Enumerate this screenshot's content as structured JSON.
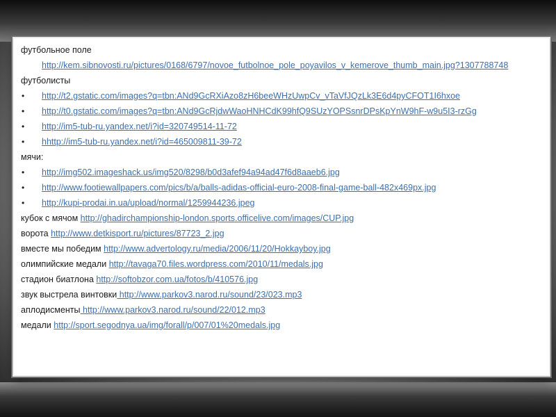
{
  "items": [
    {
      "type": "label",
      "text": "футбольное поле"
    },
    {
      "type": "indent-link",
      "link": "http://kem.sibnovosti.ru/pictures/0168/6797/novoe_futbolnoe_pole_poyavilos_v_kemerove_thumb_main.jpg?1307788748"
    },
    {
      "type": "label",
      "text": "футболисты"
    },
    {
      "type": "bullet",
      "link": "http://t2.gstatic.com/images?q=tbn:ANd9GcRXiAzo8zH6beeWHzUwpCv_vTaVfJQzLk3E6d4pyCFOT1I6hxoe"
    },
    {
      "type": "bullet",
      "link": "http://t0.gstatic.com/images?q=tbn:ANd9GcRjdwWaoHNHCdK99hfQ9SUzYOPSsnrDPsKpYnW9hF-w9u5I3-rzGg"
    },
    {
      "type": "bullet",
      "link": "http://im5-tub-ru.yandex.net/i?id=320749514-11-72"
    },
    {
      "type": "bullet",
      "link": "hhttp://im5-tub-ru.yandex.net/i?id=465009811-39-72"
    },
    {
      "type": "label",
      "text": "мячи:"
    },
    {
      "type": "bullet",
      "link": "http://img502.imageshack.us/img520/8298/b0d3afef94a94ad47f6d8aaeb6.jpg"
    },
    {
      "type": "bullet",
      "link": "http://www.footiewallpapers.com/pics/b/a/balls-adidas-official-euro-2008-final-game-ball-482x469px.jpg"
    },
    {
      "type": "bullet",
      "link": "http://kupi-prodai.in.ua/upload/normal/1259944236.jpeg"
    },
    {
      "type": "line",
      "text": "кубок с мячом ",
      "link": "http://ghadirchampionship-london.sports.officelive.com/images/CUP.jpg"
    },
    {
      "type": "line",
      "text": "ворота ",
      "link": "http://www.detkisport.ru/pictures/87723_2.jpg"
    },
    {
      "type": "line",
      "text": "вместе мы победим ",
      "link": "http://www.advertology.ru/media/2006/11/20/Hokkayboy.jpg"
    },
    {
      "type": "line",
      "text": "олимпийские медали ",
      "link": "http://tavaga70.files.wordpress.com/2010/11/medals.jpg"
    },
    {
      "type": "line",
      "text": "стадион биатлона ",
      "link": "http://softobzor.com.ua/fotos/b/410576.jpg"
    },
    {
      "type": "line",
      "text": "звук выстрела винтовки",
      "link": " http://www.parkov3.narod.ru/sound/23/023.mp3"
    },
    {
      "type": "line",
      "text": "аплодисменты",
      "link": " http://www.parkov3.narod.ru/sound/22/012.mp3"
    },
    {
      "type": "line",
      "text": "медали ",
      "link": "http://sport.segodnya.ua/img/forall/p/007/01%20medals.jpg"
    }
  ],
  "bullet_char": "•"
}
